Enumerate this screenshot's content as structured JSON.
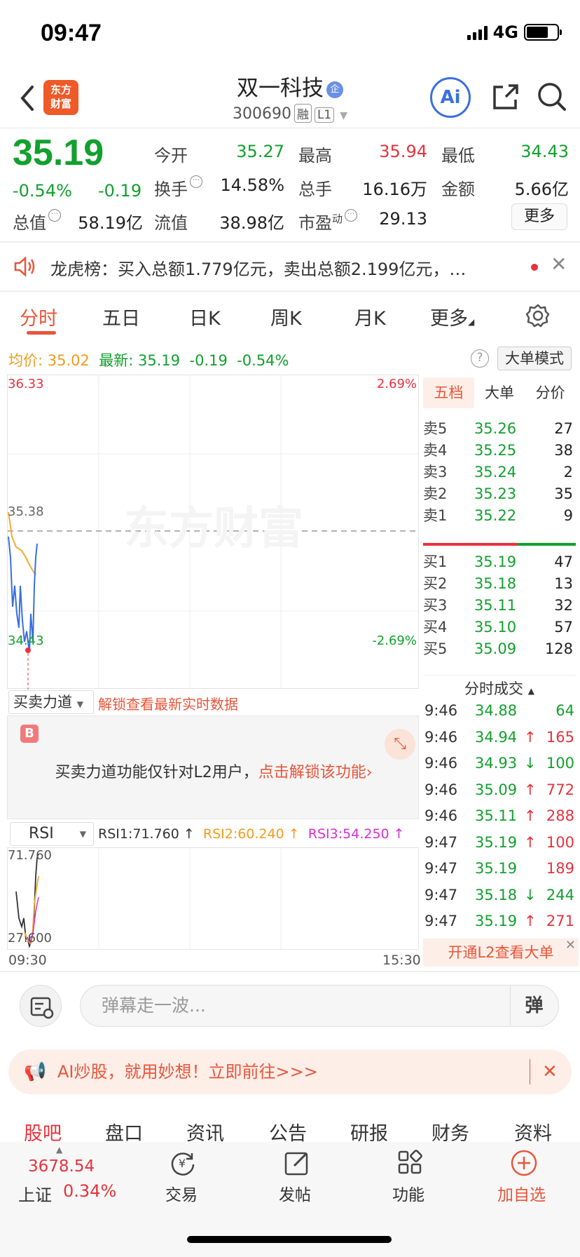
{
  "status": {
    "time": "09:47",
    "network": "4G"
  },
  "header": {
    "title": "双一科技",
    "title_badge": "企",
    "code": "300690",
    "tag_rong": "融",
    "tag_level": "L1",
    "logo": "东方\n财富",
    "ai_label": "Ai"
  },
  "quote": {
    "price": "35.19",
    "change_pct": "-0.54%",
    "change": "-0.19",
    "fields": {
      "open_label": "今开",
      "open": "35.27",
      "high_label": "最高",
      "high": "35.94",
      "low_label": "最低",
      "low": "34.43",
      "turnover_label": "换手",
      "turnover": "14.58%",
      "volume_label": "总手",
      "volume": "16.16万",
      "amount_label": "金额",
      "amount": "5.66亿",
      "mcap_label": "总值",
      "mcap": "58.19亿",
      "float_label": "流值",
      "float": "38.98亿",
      "pe_label": "市盈",
      "pe_sup": "动",
      "pe": "29.13"
    },
    "more": "更多"
  },
  "notice": {
    "text": "龙虎榜：买入总额1.779亿元，卖出总额2.199亿元，…"
  },
  "tabs": [
    "分时",
    "五日",
    "日K",
    "周K",
    "月K",
    "更多"
  ],
  "intraday": {
    "avg_label": "均价:",
    "avg": "35.02",
    "latest_label": "最新:",
    "latest": "35.19",
    "chg": "-0.19",
    "pct": "-0.54%",
    "big_mode": "大单模式",
    "y_max": "36.33",
    "y_min": "34.43",
    "pct_max": "2.69%",
    "pct_min": "-2.69%",
    "ref": "35.38",
    "watermark": "东方财富",
    "marker": "B"
  },
  "orderbook": {
    "tabs": [
      "五档",
      "大单",
      "分价"
    ],
    "asks": [
      {
        "l": "卖5",
        "p": "35.26",
        "v": "27"
      },
      {
        "l": "卖4",
        "p": "35.25",
        "v": "38"
      },
      {
        "l": "卖3",
        "p": "35.24",
        "v": "2"
      },
      {
        "l": "卖2",
        "p": "35.23",
        "v": "35"
      },
      {
        "l": "卖1",
        "p": "35.22",
        "v": "9"
      }
    ],
    "bids": [
      {
        "l": "买1",
        "p": "35.19",
        "v": "47"
      },
      {
        "l": "买2",
        "p": "35.18",
        "v": "13"
      },
      {
        "l": "买3",
        "p": "35.11",
        "v": "32"
      },
      {
        "l": "买4",
        "p": "35.10",
        "v": "57"
      },
      {
        "l": "买5",
        "p": "35.09",
        "v": "128"
      }
    ]
  },
  "trades": {
    "title": "分时成交",
    "rows": [
      {
        "t": "9:46",
        "p": "34.88",
        "v": "64",
        "c": "g",
        "a": ""
      },
      {
        "t": "9:46",
        "p": "34.94",
        "v": "165",
        "c": "r",
        "a": "↑"
      },
      {
        "t": "9:46",
        "p": "34.93",
        "v": "100",
        "c": "g",
        "a": "↓"
      },
      {
        "t": "9:46",
        "p": "35.09",
        "v": "772",
        "c": "r",
        "a": "↑"
      },
      {
        "t": "9:46",
        "p": "35.11",
        "v": "288",
        "c": "r",
        "a": "↑"
      },
      {
        "t": "9:47",
        "p": "35.19",
        "v": "100",
        "c": "r",
        "a": "↑"
      },
      {
        "t": "9:47",
        "p": "35.19",
        "v": "189",
        "c": "r",
        "a": ""
      },
      {
        "t": "9:47",
        "p": "35.18",
        "v": "244",
        "c": "g",
        "a": "↓"
      },
      {
        "t": "9:47",
        "p": "35.19",
        "v": "271",
        "c": "r",
        "a": "↑"
      }
    ],
    "l2_promo": "开通L2查看大单"
  },
  "indicator": {
    "select": "买卖力道",
    "unlock_link": "解锁查看最新实时数据",
    "lock_text": "买卖力道功能仅针对L2用户，",
    "lock_action": "点击解锁该功能"
  },
  "rsi": {
    "select": "RSI",
    "rsi1": "RSI1:71.760 ↑",
    "rsi2": "RSI2:60.240 ↑",
    "rsi3": "RSI3:54.250 ↑",
    "y_max": "71.760",
    "y_min": "27.600",
    "x_start": "09:30",
    "x_end": "15:30"
  },
  "danmaku": {
    "placeholder": "弹幕走一波...",
    "btn": "弹"
  },
  "ai_banner": {
    "text": "AI炒股，就用妙想！立即前往>>>"
  },
  "sections": [
    "股吧",
    "盘口",
    "资讯",
    "公告",
    "研报",
    "财务",
    "资料"
  ],
  "footer": {
    "index_value": "3678.54",
    "index_name": "上证",
    "index_pct": "0.34%",
    "trade": "交易",
    "post": "发帖",
    "func": "功能",
    "add": "加自选"
  }
}
